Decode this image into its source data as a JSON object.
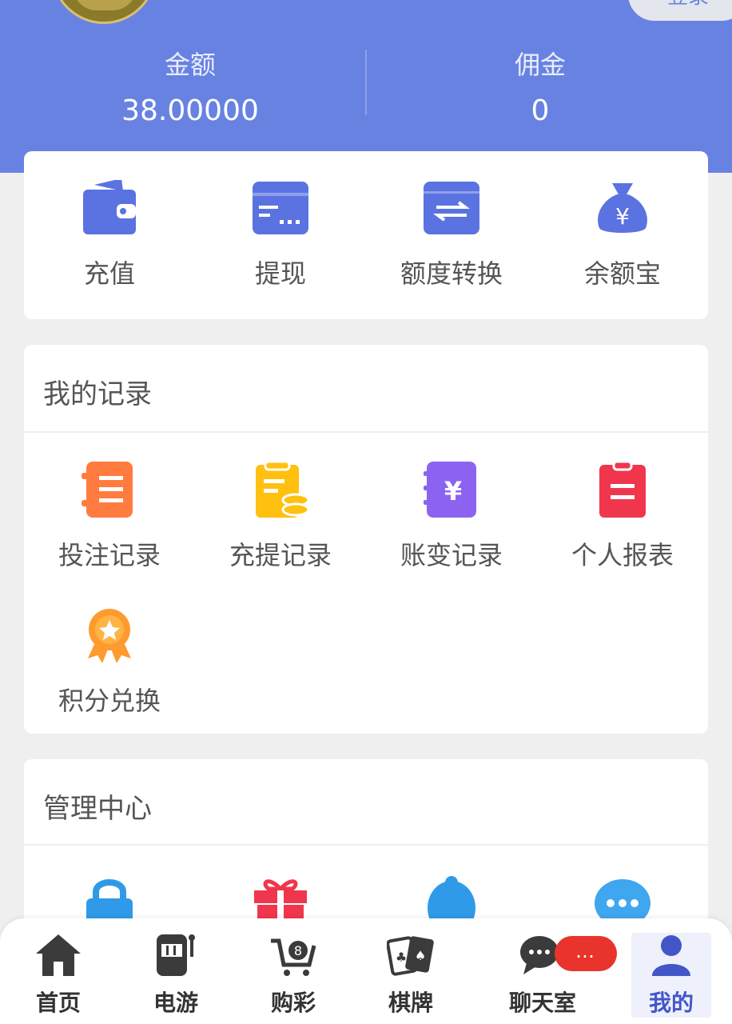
{
  "header": {
    "top_right_label": "登录",
    "balance": {
      "label": "金额",
      "value": "38.00000"
    },
    "commission": {
      "label": "佣金",
      "value": "0"
    }
  },
  "quick_actions": [
    {
      "label": "充值",
      "icon": "wallet-icon"
    },
    {
      "label": "提现",
      "icon": "card-icon"
    },
    {
      "label": "额度转换",
      "icon": "transfer-icon"
    },
    {
      "label": "余额宝",
      "icon": "money-bag-icon"
    }
  ],
  "records": {
    "title": "我的记录",
    "items": [
      {
        "label": "投注记录",
        "icon": "notebook-icon"
      },
      {
        "label": "充提记录",
        "icon": "clipboard-coins-icon"
      },
      {
        "label": "账变记录",
        "icon": "yuan-book-icon"
      },
      {
        "label": "个人报表",
        "icon": "report-icon"
      },
      {
        "label": "积分兑换",
        "icon": "medal-icon"
      }
    ]
  },
  "management": {
    "title": "管理中心",
    "icons": [
      "lock-icon",
      "gift-icon",
      "service-agent-icon",
      "chat-bubble-icon"
    ]
  },
  "tabbar": {
    "items": [
      {
        "label": "首页",
        "icon": "home-icon"
      },
      {
        "label": "电游",
        "icon": "slot-machine-icon"
      },
      {
        "label": "购彩",
        "icon": "lottery-cart-icon"
      },
      {
        "label": "棋牌",
        "icon": "playing-cards-icon"
      },
      {
        "label": "聊天室",
        "icon": "chat-icon"
      },
      {
        "label": "我的",
        "icon": "user-icon"
      }
    ],
    "chat_badge": "…",
    "active_index": 5
  },
  "colors": {
    "header": "#6882e2",
    "icon_blue": "#5b73e0",
    "orange": "#ff7c3e",
    "yellow": "#ffc00f",
    "purple": "#8c63f0",
    "red": "#f0364d",
    "active_tab": "#4356c8"
  }
}
